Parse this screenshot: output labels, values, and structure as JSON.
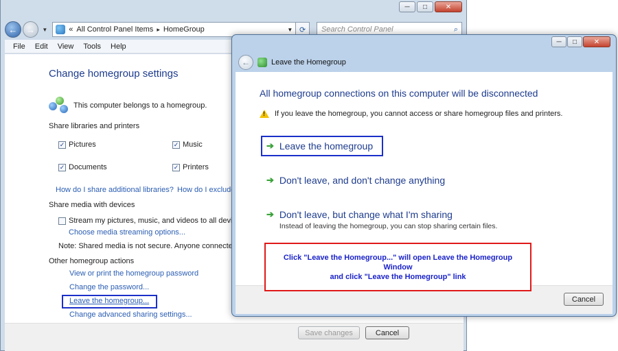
{
  "colors": {
    "accent": "#1e3c8e",
    "link": "#2a5db3",
    "highlight_blue": "#1a2fc9",
    "highlight_red": "#e01818",
    "arrow_green": "#3aa23a"
  },
  "main_window": {
    "titlebar": {
      "minimize": "─",
      "maximize": "□",
      "close": "✕"
    },
    "address": {
      "prefix": "«",
      "crumb1": "All Control Panel Items",
      "sep": "▸",
      "crumb2": "HomeGroup"
    },
    "search": {
      "placeholder": "Search Control Panel"
    },
    "menu": [
      "File",
      "Edit",
      "View",
      "Tools",
      "Help"
    ],
    "title": "Change homegroup settings",
    "belongs": "This computer belongs to a homegroup.",
    "share_label": "Share libraries and printers",
    "libraries": [
      {
        "label": "Pictures",
        "checked": true
      },
      {
        "label": "Music",
        "checked": true
      },
      {
        "label": "Documents",
        "checked": true
      },
      {
        "label": "Printers",
        "checked": true
      }
    ],
    "link_share_more": "How do I share additional libraries?",
    "link_exclude": "How do I exclude",
    "media_label": "Share media with devices",
    "stream_label": "Stream my pictures, music, and videos to all device",
    "link_streaming": "Choose media streaming options...",
    "note": "Note: Shared media is not secure. Anyone connected",
    "other_label": "Other homegroup actions",
    "actions": [
      "View or print the homegroup password",
      "Change the password...",
      "Leave the homegroup...",
      "Change advanced sharing settings..."
    ],
    "save_button": "Save changes",
    "cancel_button": "Cancel"
  },
  "dialog": {
    "title": "Leave the Homegroup",
    "heading": "All homegroup connections on this computer will be disconnected",
    "warning": "If you leave the homegroup, you cannot access or share homegroup files and printers.",
    "options": [
      {
        "label": "Leave the homegroup",
        "sub": ""
      },
      {
        "label": "Don't leave, and don't change anything",
        "sub": ""
      },
      {
        "label": "Don't leave, but change what I'm sharing",
        "sub": "Instead of leaving the homegroup, you can stop sharing certain files."
      }
    ],
    "annotation_line1": "Click \"Leave the Homegroup...\" will open Leave the Homegroup Window",
    "annotation_line2": "and click \"Leave the Homegroup\" link",
    "cancel_button": "Cancel"
  }
}
